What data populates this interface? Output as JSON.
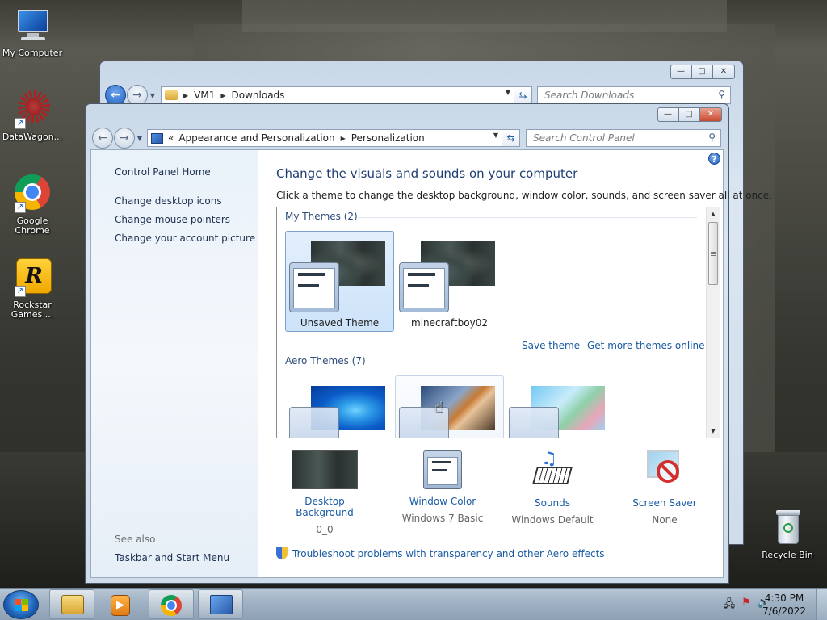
{
  "desktop": {
    "icons": [
      {
        "label": "My Computer",
        "icon": "computer-icon"
      },
      {
        "label": "DataWagon...",
        "icon": "datawagon-icon"
      },
      {
        "label": "Google Chrome",
        "icon": "chrome-icon"
      },
      {
        "label": "Rockstar Games ...",
        "icon": "rockstar-icon"
      },
      {
        "label": "Recycle Bin",
        "icon": "recycle-bin-icon"
      }
    ]
  },
  "downloads_window": {
    "breadcrumb": [
      "VM1",
      "Downloads"
    ],
    "search_placeholder": "Search Downloads"
  },
  "personalization": {
    "breadcrumb_prefix": "«",
    "breadcrumb": [
      "Appearance and Personalization",
      "Personalization"
    ],
    "search_placeholder": "Search Control Panel",
    "left_pane": {
      "home": "Control Panel Home",
      "links": [
        "Change desktop icons",
        "Change mouse pointers",
        "Change your account picture"
      ],
      "see_also_heading": "See also",
      "see_also": [
        "Taskbar and Start Menu"
      ]
    },
    "heading": "Change the visuals and sounds on your computer",
    "subheading": "Click a theme to change the desktop background, window color, sounds, and screen saver all at once.",
    "groups": {
      "my_themes": "My Themes (2)",
      "aero_themes": "Aero Themes (7)"
    },
    "my_themes": [
      {
        "name": "Unsaved Theme",
        "selected": true
      },
      {
        "name": "minecraftboy02",
        "selected": false
      }
    ],
    "actions": {
      "save_theme": "Save theme",
      "get_more": "Get more themes online"
    },
    "settings": [
      {
        "label": "Desktop Background",
        "value": "0_0",
        "icon": "desktop-background-icon"
      },
      {
        "label": "Window Color",
        "value": "Windows 7 Basic",
        "icon": "window-color-icon"
      },
      {
        "label": "Sounds",
        "value": "Windows Default",
        "icon": "sounds-icon"
      },
      {
        "label": "Screen Saver",
        "value": "None",
        "icon": "screen-saver-icon"
      }
    ],
    "troubleshoot": "Troubleshoot problems with transparency and other Aero effects"
  },
  "taskbar": {
    "time": "4:30 PM",
    "date": "7/6/2022",
    "pinned": [
      "explorer-icon",
      "media-player-icon",
      "chrome-icon",
      "control-panel-icon"
    ]
  }
}
